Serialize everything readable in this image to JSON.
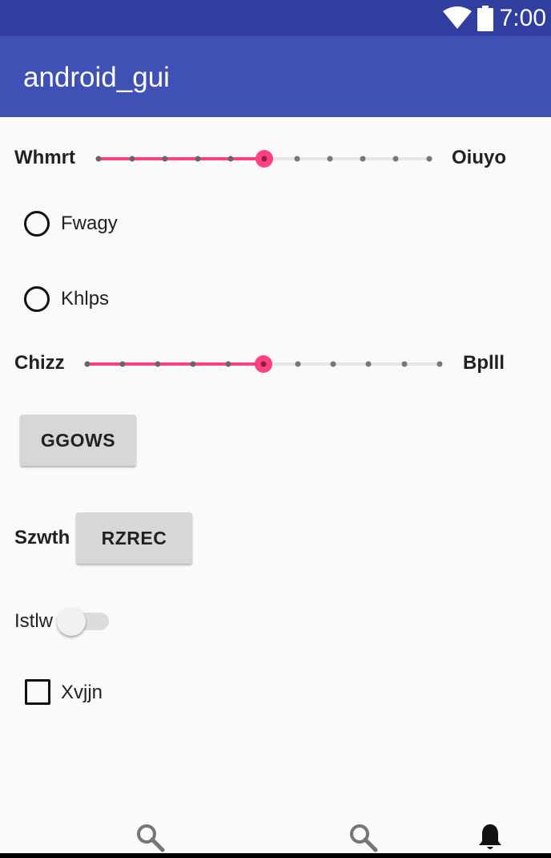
{
  "status_bar": {
    "time": "7:00",
    "icons": [
      "wifi-icon",
      "battery-icon"
    ]
  },
  "app_bar": {
    "title": "android_gui"
  },
  "slider1": {
    "left_label": "Whmrt",
    "right_label": "Oiuyo",
    "value": 5,
    "max": 10
  },
  "radio1": {
    "label": "Fwagy",
    "checked": false
  },
  "radio2": {
    "label": "Khlps",
    "checked": false
  },
  "slider2": {
    "left_label": "Chizz",
    "right_label": "Bplll",
    "value": 5,
    "max": 10
  },
  "button1": {
    "label": "GGOWS"
  },
  "row_szwth": {
    "label": "Szwth",
    "button_label": "RZREC"
  },
  "switch1": {
    "label": "Istlw",
    "on": false
  },
  "checkbox1": {
    "label": "Xvjjn",
    "checked": false
  },
  "bottom_nav": {
    "items": [
      "search-icon",
      "search-icon",
      "bell-icon"
    ]
  },
  "colors": {
    "status_bar": "#303f9f",
    "app_bar": "#3f51b5",
    "accent": "#ff4081",
    "background": "#fafafa"
  }
}
